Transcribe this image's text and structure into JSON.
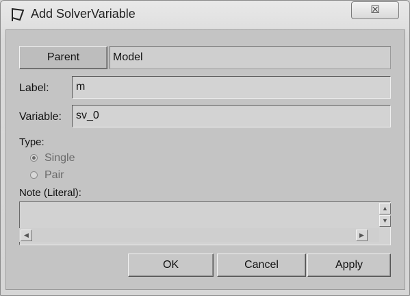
{
  "window": {
    "title": "Add SolverVariable",
    "close_glyph": "☒"
  },
  "parent": {
    "button_label": "Parent",
    "value": "Model"
  },
  "form": {
    "label_caption": "Label:",
    "label_value": "m",
    "variable_caption": "Variable:",
    "variable_value": "sv_0",
    "type_caption": "Type:",
    "type_options": [
      {
        "label": "Single",
        "selected": true
      },
      {
        "label": "Pair",
        "selected": false
      }
    ],
    "note_caption": "Note (Literal):",
    "note_value": ""
  },
  "scroll": {
    "up": "▲",
    "down": "▼",
    "left": "◀",
    "right": "▶"
  },
  "actions": {
    "ok": "OK",
    "cancel": "Cancel",
    "apply": "Apply"
  },
  "icons": {
    "window": "solver-variable-icon",
    "close": "close-icon"
  }
}
